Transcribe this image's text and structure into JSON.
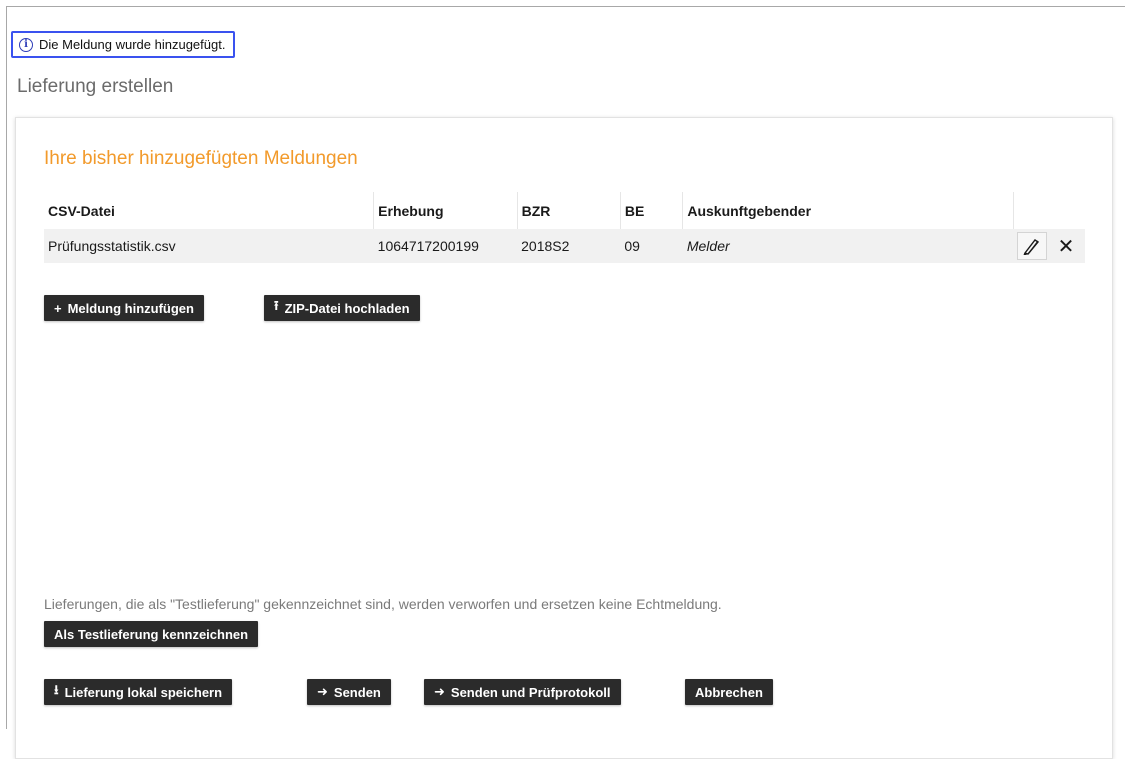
{
  "notice": {
    "text": "Die Meldung wurde hinzugefügt.",
    "icon": "info-icon"
  },
  "page": {
    "title": "Lieferung erstellen"
  },
  "card": {
    "title": "Ihre bisher hinzugefügten Meldungen",
    "table": {
      "headers": {
        "file": "CSV-Datei",
        "erhebung": "Erhebung",
        "bzr": "BZR",
        "be": "BE",
        "auskunft": "Auskunftgebender"
      },
      "rows": [
        {
          "file": "Prüfungsstatistik.csv",
          "erhebung": "1064717200199",
          "bzr": "2018S2",
          "be": "09",
          "auskunft": "Melder"
        }
      ]
    },
    "buttons": {
      "add_meldung": "Meldung hinzufügen",
      "upload_zip": "ZIP-Datei hochladen"
    },
    "hint": "Lieferungen, die als \"Testlieferung\" gekennzeichnet sind, werden verworfen und ersetzen keine Echtmeldung.",
    "mark_test": "Als Testlieferung kennzeichnen",
    "actions": {
      "save_local": "Lieferung lokal speichern",
      "send": "Senden",
      "send_protocol": "Senden und Prüfprotokoll",
      "cancel": "Abbrechen"
    }
  },
  "colors": {
    "accent_orange": "#f29a2b",
    "notice_border": "#3a52ef",
    "button_bg": "#2b2b2b"
  }
}
